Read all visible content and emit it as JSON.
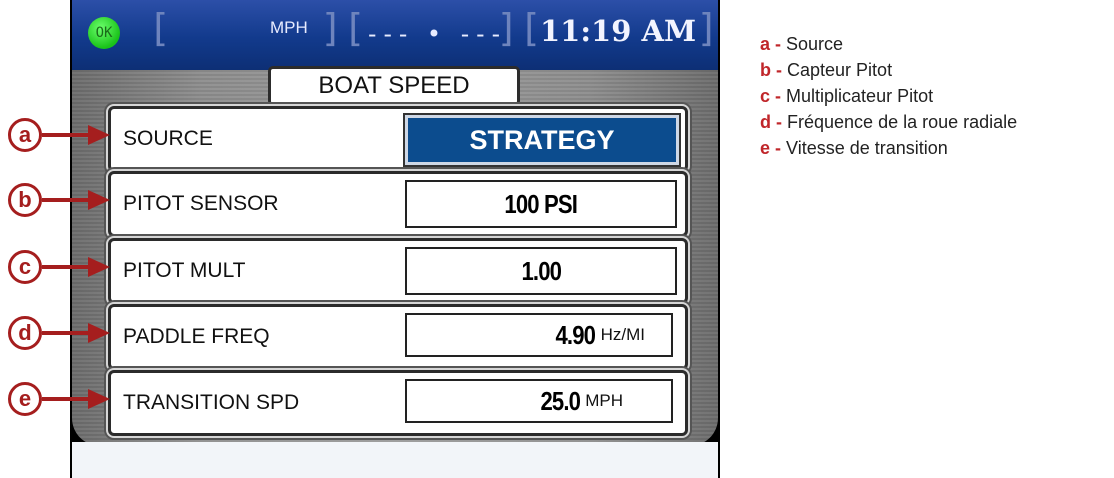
{
  "status": {
    "ok": "OK",
    "speed_unit": "MPH",
    "speed_readout": "--- • ---",
    "time": "11:19 AM"
  },
  "page_title": "BOAT SPEED",
  "rows": [
    {
      "callout": "a",
      "label": "SOURCE",
      "value": "STRATEGY",
      "unit": ""
    },
    {
      "callout": "b",
      "label": "PITOT SENSOR",
      "value": "100 PSI",
      "unit": ""
    },
    {
      "callout": "c",
      "label": "PITOT MULT",
      "value": "1.00",
      "unit": ""
    },
    {
      "callout": "d",
      "label": "PADDLE FREQ",
      "value": "4.90",
      "unit": "Hz/MI"
    },
    {
      "callout": "e",
      "label": "TRANSITION SPD",
      "value": "25.0",
      "unit": "MPH"
    }
  ],
  "legend": [
    {
      "letter": "a -",
      "text": "Source"
    },
    {
      "letter": "b -",
      "text": "Capteur Pitot"
    },
    {
      "letter": "c -",
      "text": "Multiplicateur Pitot"
    },
    {
      "letter": "d -",
      "text": "Fréquence de la roue radiale"
    },
    {
      "letter": "e -",
      "text": "Vitesse de transition"
    }
  ],
  "colors": {
    "header_blue": "#123a8c",
    "callout_red": "#a51e1e",
    "selected_blue": "#0c4c8e",
    "ok_green": "#19c219"
  }
}
